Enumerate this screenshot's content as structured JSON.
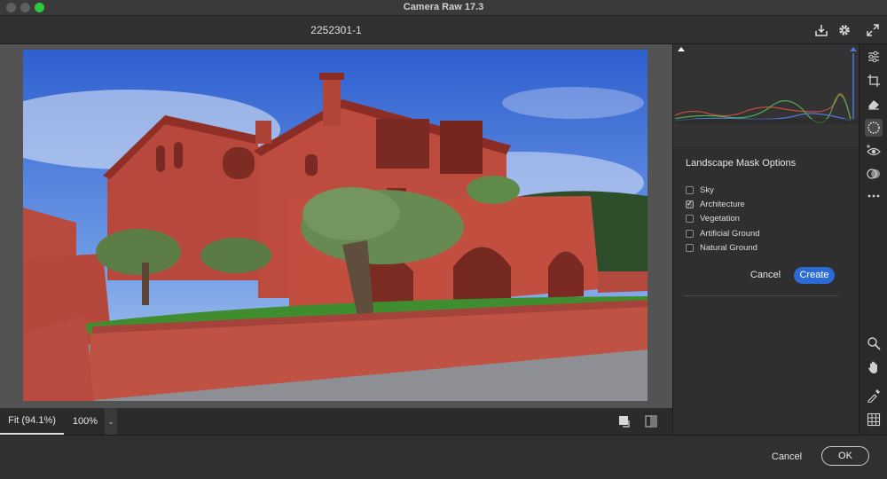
{
  "window": {
    "title": "Camera Raw 17.3"
  },
  "file": {
    "name": "2252301-1"
  },
  "zoom": {
    "fit_label": "Fit (94.1%)",
    "pct_label": "100%"
  },
  "mask_panel": {
    "title": "Landscape Mask Options",
    "options": [
      {
        "label": "Sky",
        "checked": false
      },
      {
        "label": "Architecture",
        "checked": true
      },
      {
        "label": "Vegetation",
        "checked": false
      },
      {
        "label": "Artificial Ground",
        "checked": false
      },
      {
        "label": "Natural Ground",
        "checked": false
      }
    ],
    "cancel_label": "Cancel",
    "create_label": "Create"
  },
  "footer": {
    "cancel_label": "Cancel",
    "ok_label": "OK"
  },
  "colors": {
    "accent": "#2c6bd6",
    "mask_overlay": "#c0392b",
    "sky": "#3b6fd6"
  },
  "icons": [
    "save-icon",
    "gear-icon",
    "fullscreen-icon",
    "edit-sliders-icon",
    "crop-icon",
    "eraser-icon",
    "masking-icon",
    "redeye-icon",
    "presets-icon",
    "more-icon",
    "zoom-icon",
    "hand-icon",
    "color-sampler-icon",
    "grid-icon",
    "single-view-icon",
    "compare-view-icon"
  ]
}
